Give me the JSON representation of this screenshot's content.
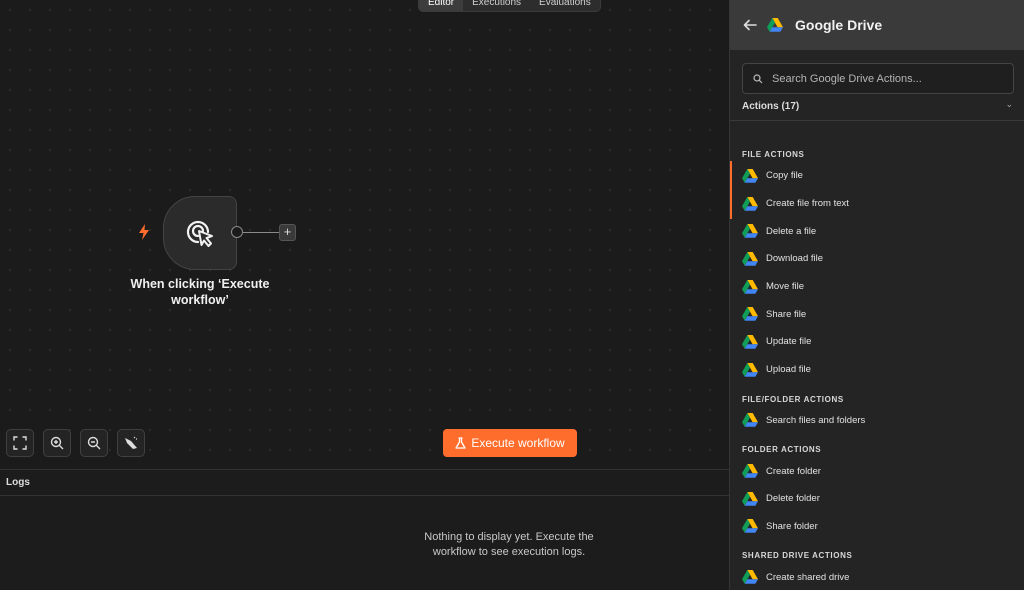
{
  "tabs": [
    "Editor",
    "Executions",
    "Evaluations"
  ],
  "node": {
    "label": "When clicking ‘Execute workflow’",
    "icon": "cursor-click-icon"
  },
  "canvas_controls": [
    "fit-view-icon",
    "zoom-in-icon",
    "zoom-out-icon",
    "tidy-up-icon"
  ],
  "execute_button": "Execute workflow",
  "logs": {
    "title": "Logs",
    "empty_message": "Nothing to display yet. Execute the workflow to see execution logs."
  },
  "panel": {
    "title": "Google Drive",
    "search_placeholder": "Search Google Drive Actions...",
    "actions_header": "Actions (17)",
    "sections": [
      {
        "title": "FILE ACTIONS",
        "items": [
          "Copy file",
          "Create file from text",
          "Delete a file",
          "Download file",
          "Move file",
          "Share file",
          "Update file",
          "Upload file"
        ]
      },
      {
        "title": "FILE/FOLDER ACTIONS",
        "items": [
          "Search files and folders"
        ]
      },
      {
        "title": "FOLDER ACTIONS",
        "items": [
          "Create folder",
          "Delete folder",
          "Share folder"
        ]
      },
      {
        "title": "SHARED DRIVE ACTIONS",
        "items": [
          "Create shared drive"
        ]
      }
    ]
  },
  "colors": {
    "accent": "#ff6d2d",
    "panel_header": "#3a3a3a",
    "canvas_bg": "#1b1b1b"
  }
}
